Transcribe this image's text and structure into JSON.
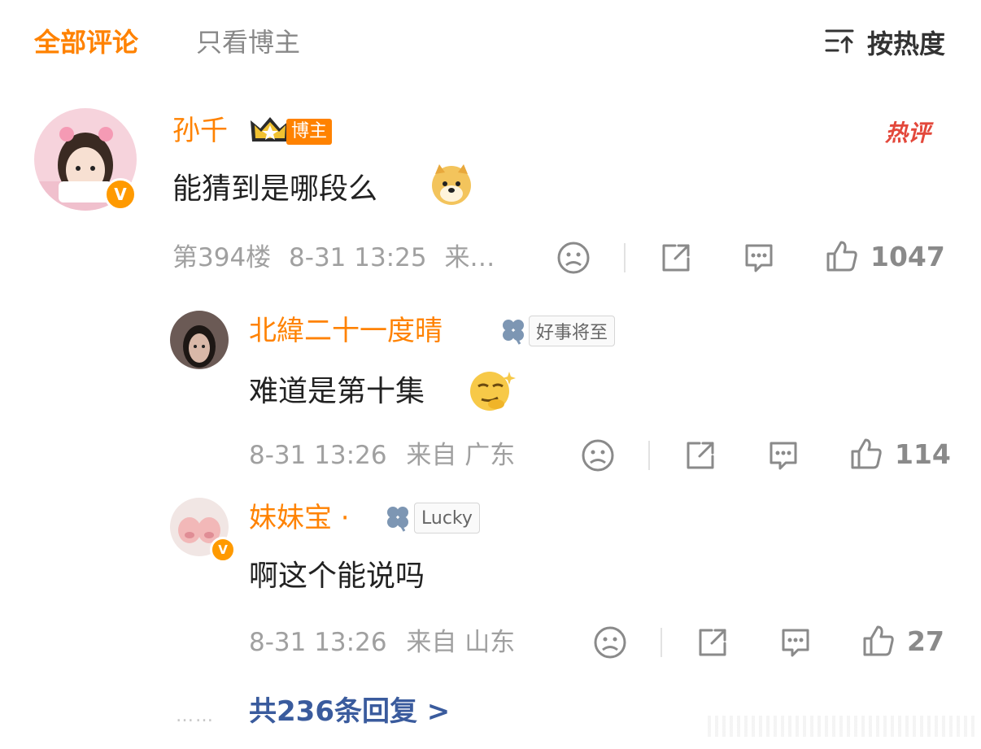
{
  "tabs": {
    "all": "全部评论",
    "blogger_only": "只看博主",
    "sort": "按热度"
  },
  "comment": {
    "username": "孙千",
    "blogger_tag": "博主",
    "hot_label": "热评",
    "text": "能猜到是哪段么",
    "floor": "第394楼",
    "time": "8-31 13:25",
    "location": "来…",
    "likes": "1047"
  },
  "replies": [
    {
      "username": "北緯二十一度晴",
      "badge": "好事将至",
      "text": "难道是第十集",
      "time": "8-31 13:26",
      "location": "来自 广东",
      "likes": "114"
    },
    {
      "username": "妹妹宝 ·",
      "badge": "Lucky",
      "text": "啊这个能说吗",
      "time": "8-31 13:26",
      "location": "来自 山东",
      "likes": "27"
    }
  ],
  "more_replies": "共236条回复 >",
  "more_dots": "……",
  "verified_mark": "V",
  "colors": {
    "accent": "#ff8200",
    "link": "#3a5b9d",
    "hot": "#e3483b",
    "muted": "#a0a0a0"
  }
}
